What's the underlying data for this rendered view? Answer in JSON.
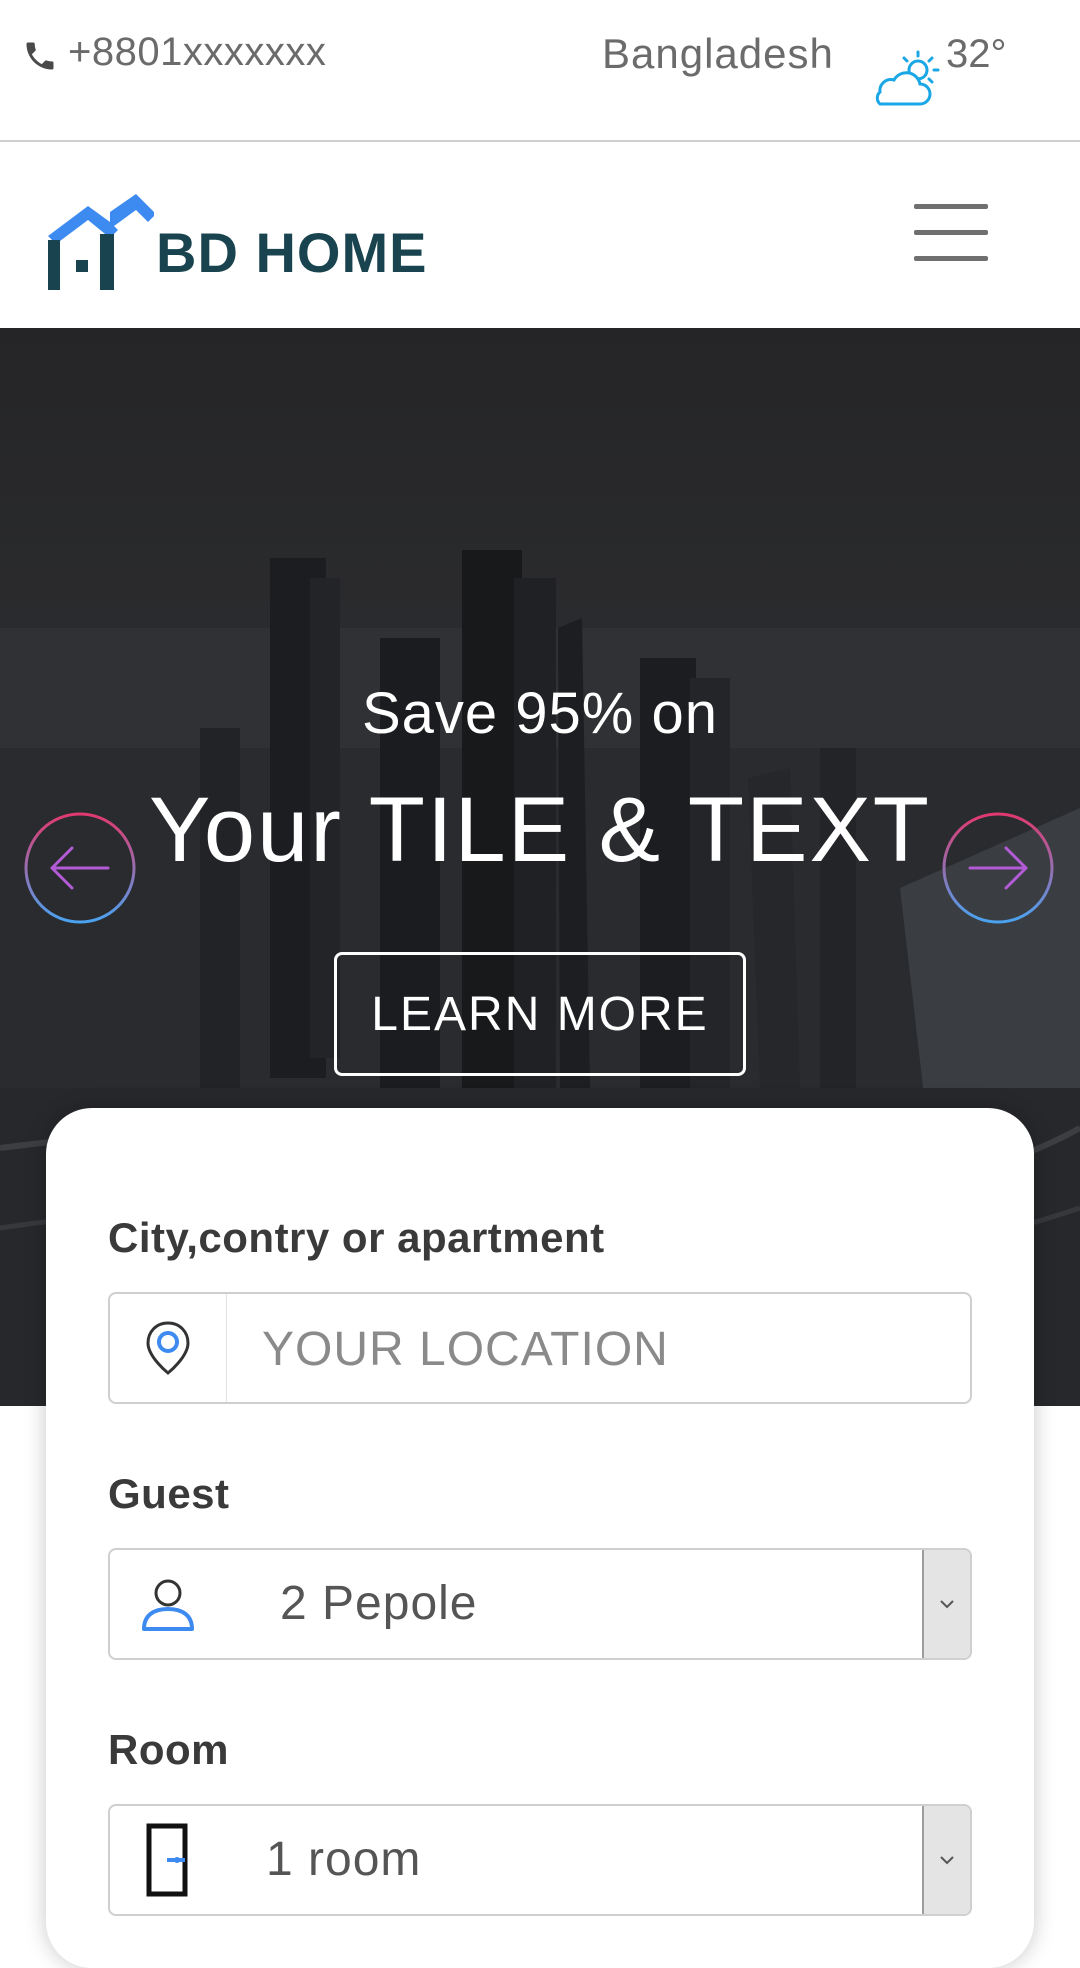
{
  "topbar": {
    "phone": "+8801xxxxxxx",
    "country": "Bangladesh",
    "temperature": "32°",
    "phone_icon": "phone-icon",
    "weather_icon": "partly-cloudy-icon"
  },
  "navbar": {
    "logo_text": "BD HOME",
    "menu_icon": "hamburger-icon"
  },
  "hero": {
    "subtitle": "Save 95% on",
    "title": "Your TILE & TEXT",
    "cta_label": "LEARN MORE",
    "prev_icon": "arrow-left-icon",
    "next_icon": "arrow-right-icon"
  },
  "search": {
    "location_label": "City,contry or apartment",
    "location_placeholder": "YOUR LOCATION",
    "guest_label": "Guest",
    "guest_value": "2 Pepole",
    "room_label": "Room",
    "room_value": "1 room"
  },
  "colors": {
    "logo_blue": "#3d8bf0",
    "logo_dark": "#19444f",
    "arrow_gradient_start": "#e2396f",
    "arrow_gradient_end": "#4aa3f0",
    "weather_blue": "#1aa7e6"
  }
}
